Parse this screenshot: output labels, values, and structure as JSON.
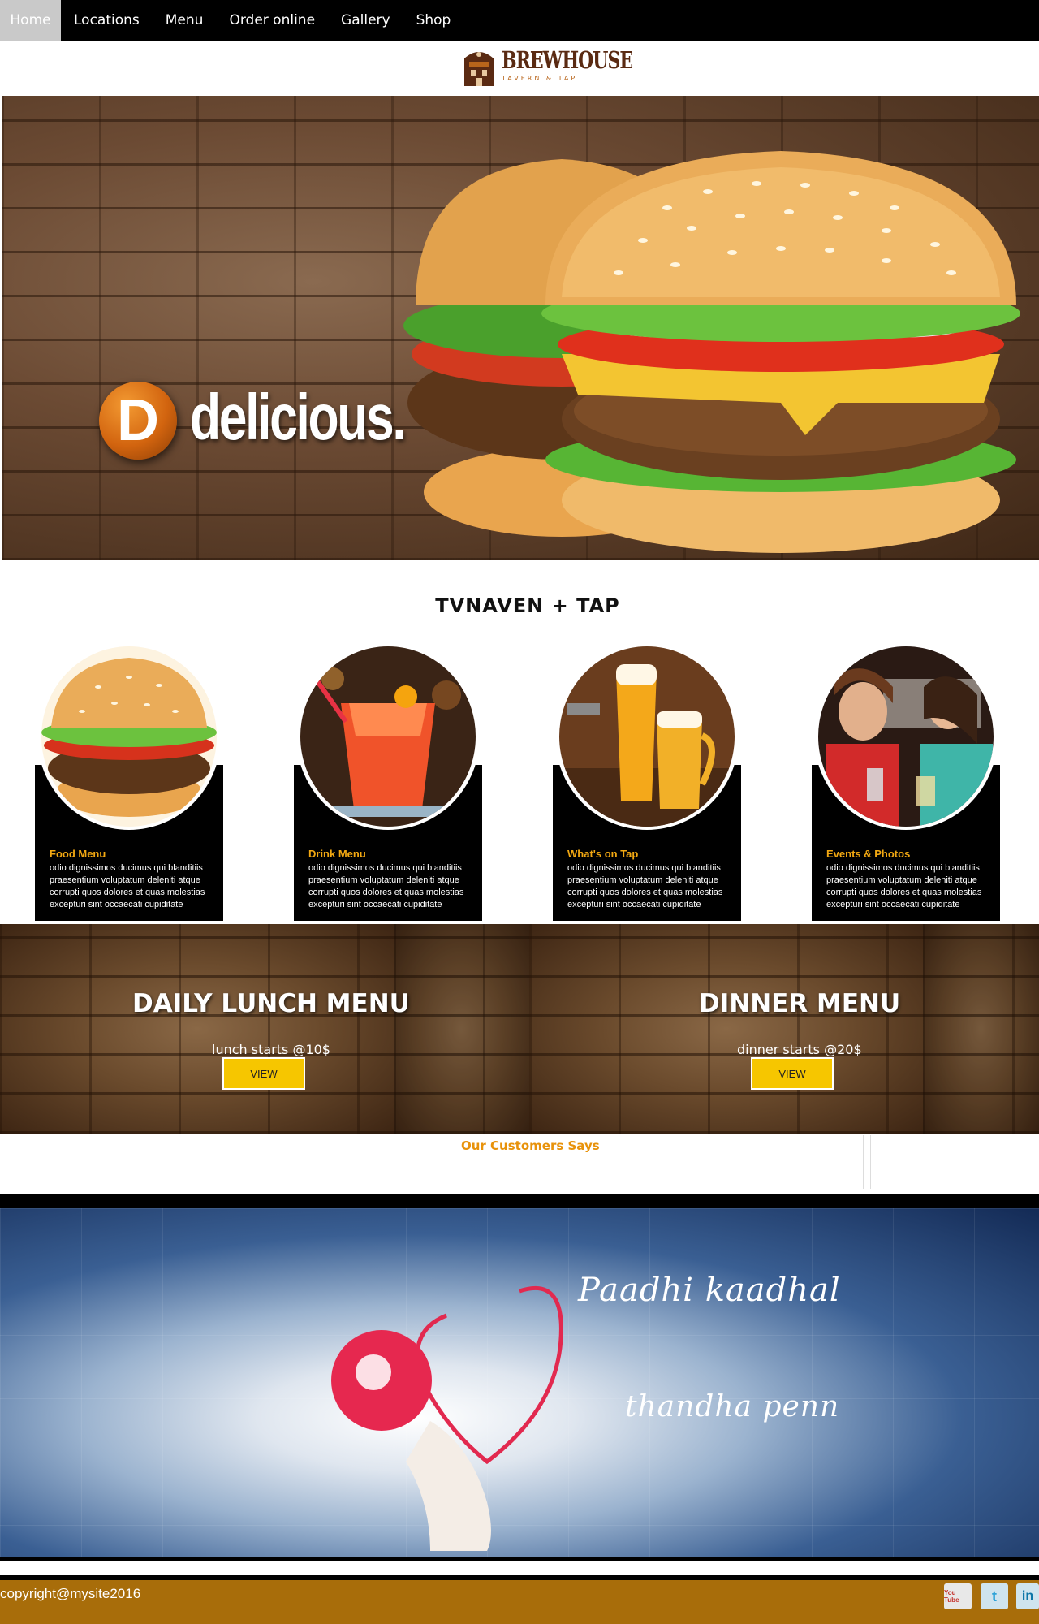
{
  "nav": {
    "items": [
      {
        "label": "Home",
        "active": true
      },
      {
        "label": "Locations"
      },
      {
        "label": "Menu"
      },
      {
        "label": "Order online"
      },
      {
        "label": "Gallery"
      },
      {
        "label": "Shop"
      }
    ]
  },
  "logo": {
    "name": "BREWHOUSE",
    "tagline": "TAVERN & TAP"
  },
  "hero": {
    "badge_letter": "D",
    "headline": "delicious."
  },
  "section": {
    "title": "TVNAVEN + TAP"
  },
  "cards": [
    {
      "title": "Food Menu",
      "text": "odio dignissimos ducimus qui blanditiis praesentium voluptatum deleniti atque corrupti quos dolores et quas molestias excepturi sint occaecati cupiditate"
    },
    {
      "title": "Drink Menu",
      "text": "odio dignissimos ducimus qui blanditiis praesentium voluptatum deleniti atque corrupti quos dolores et quas molestias excepturi sint occaecati cupiditate"
    },
    {
      "title": "What's on Tap",
      "text": "odio dignissimos ducimus qui blanditiis praesentium voluptatum deleniti atque corrupti quos dolores et quas molestias excepturi sint occaecati cupiditate"
    },
    {
      "title": "Events & Photos",
      "text": "odio dignissimos ducimus qui blanditiis praesentium voluptatum deleniti atque corrupti quos dolores et quas molestias excepturi sint occaecati cupiditate"
    }
  ],
  "menus": {
    "lunch": {
      "heading": "DAILY LUNCH MENU",
      "note": "lunch starts @10$",
      "button": "VIEW"
    },
    "dinner": {
      "heading": "DINNER MENU",
      "note": "dinner starts @20$",
      "button": "VIEW"
    }
  },
  "customers": {
    "heading": "Our Customers Says"
  },
  "video": {
    "line1": "Paadhi kaadhal",
    "line2": "thandha penn"
  },
  "footer": {
    "copyright": "copyright@mysite2016",
    "social": [
      {
        "label": "You Tube",
        "icon": "youtube-icon",
        "color": "#c4302b"
      },
      {
        "label": "t",
        "icon": "twitter-icon",
        "color": "#2fa3d8"
      },
      {
        "label": "in",
        "icon": "linkedin-icon",
        "color": "#0e76a8"
      }
    ]
  }
}
